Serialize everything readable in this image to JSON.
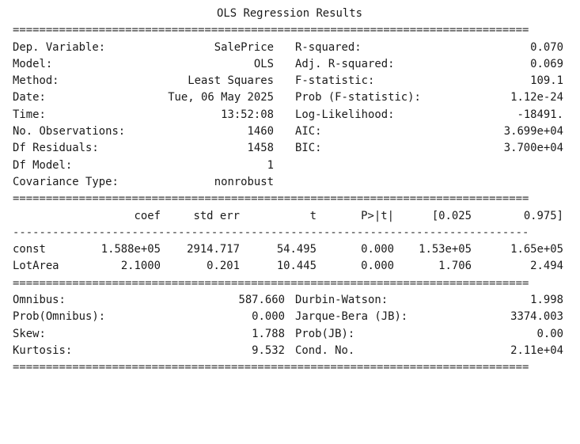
{
  "title": "OLS Regression Results",
  "rules": {
    "double": "==============================================================================",
    "single": "------------------------------------------------------------------------------"
  },
  "summary": {
    "rows": [
      {
        "label": "Dep. Variable:",
        "value": "SalePrice",
        "label2": "R-squared:",
        "value2": "0.070"
      },
      {
        "label": "Model:",
        "value": "OLS",
        "label2": "Adj. R-squared:",
        "value2": "0.069"
      },
      {
        "label": "Method:",
        "value": "Least Squares",
        "label2": "F-statistic:",
        "value2": "109.1"
      },
      {
        "label": "Date:",
        "value": "Tue, 06 May 2025",
        "label2": "Prob (F-statistic):",
        "value2": "1.12e-24"
      },
      {
        "label": "Time:",
        "value": "13:52:08",
        "label2": "Log-Likelihood:",
        "value2": "-18491."
      },
      {
        "label": "No. Observations:",
        "value": "1460",
        "label2": "AIC:",
        "value2": "3.699e+04"
      },
      {
        "label": "Df Residuals:",
        "value": "1458",
        "label2": "BIC:",
        "value2": "3.700e+04"
      },
      {
        "label": "Df Model:",
        "value": "1",
        "label2": "",
        "value2": ""
      },
      {
        "label": "Covariance Type:",
        "value": "nonrobust",
        "label2": "",
        "value2": ""
      }
    ]
  },
  "coefficients": {
    "headers": [
      "coef",
      "std err",
      "t",
      "P>|t|",
      "[0.025",
      "0.975]"
    ],
    "rows": [
      {
        "name": "const",
        "values": [
          "1.588e+05",
          "2914.717",
          "54.495",
          "0.000",
          "1.53e+05",
          "1.65e+05"
        ]
      },
      {
        "name": "LotArea",
        "values": [
          "2.1000",
          "0.201",
          "10.445",
          "0.000",
          "1.706",
          "2.494"
        ]
      }
    ]
  },
  "diagnostics": {
    "rows": [
      {
        "label": "Omnibus:",
        "value": "587.660",
        "label2": "Durbin-Watson:",
        "value2": "1.998"
      },
      {
        "label": "Prob(Omnibus):",
        "value": "0.000",
        "label2": "Jarque-Bera (JB):",
        "value2": "3374.003"
      },
      {
        "label": "Skew:",
        "value": "1.788",
        "label2": "Prob(JB):",
        "value2": "0.00"
      },
      {
        "label": "Kurtosis:",
        "value": "9.532",
        "label2": "Cond. No.",
        "value2": "2.11e+04"
      }
    ]
  }
}
